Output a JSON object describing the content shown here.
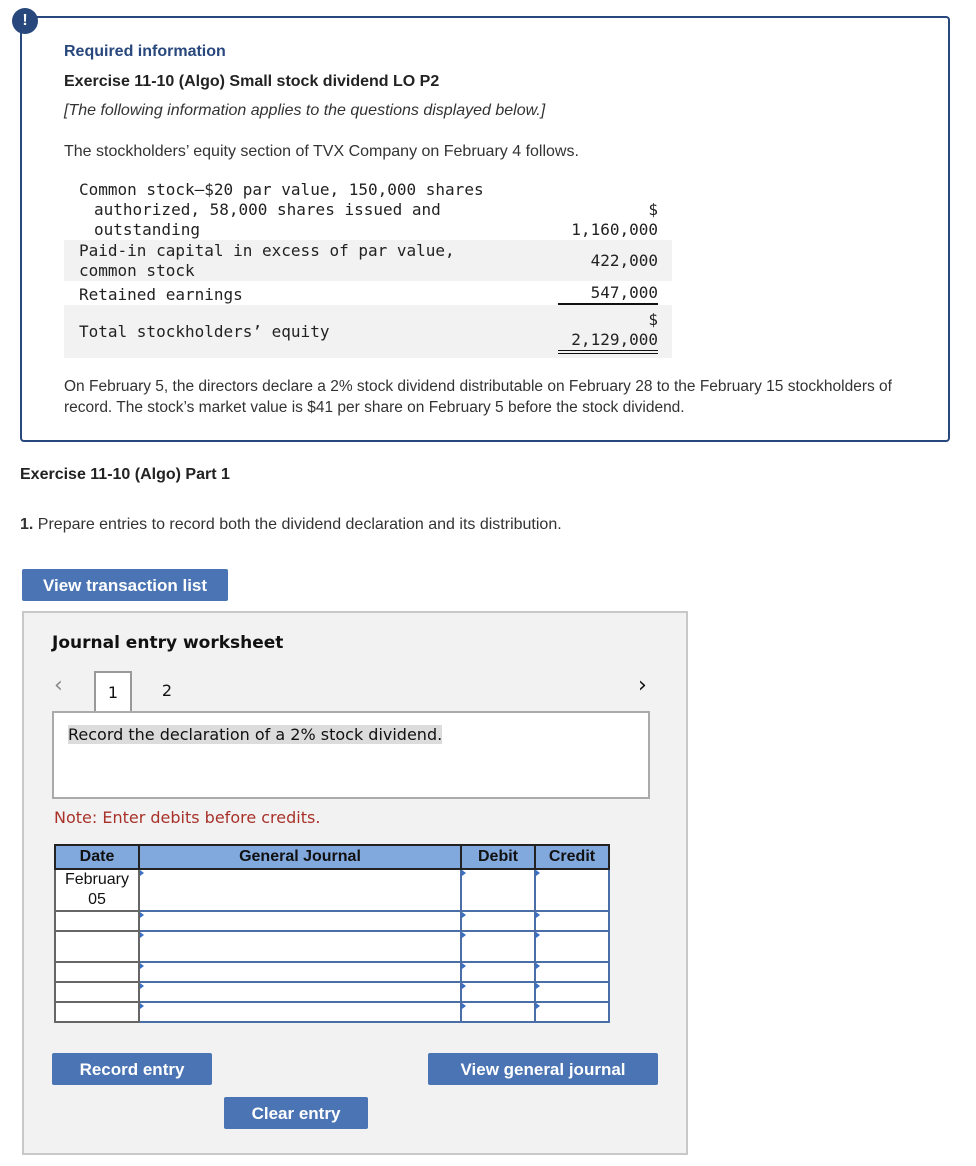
{
  "info": {
    "badge": "!",
    "required_label": "Required information",
    "exercise_title": "Exercise 11-10 (Algo) Small stock dividend LO P2",
    "applies_note": "[The following information applies to the questions displayed below.]",
    "intro": "The stockholders’ equity section of TVX Company on February 4 follows.",
    "equity_rows": [
      {
        "label_lines": [
          "Common stock—$20 par value, 150,000 shares",
          "authorized, 58,000 shares issued and",
          "outstanding"
        ],
        "currency": "$",
        "amount": "1,160,000"
      },
      {
        "label_lines": [
          "Paid-in capital in excess of par value,",
          "common stock"
        ],
        "currency": "",
        "amount": "422,000"
      },
      {
        "label_lines": [
          "Retained earnings"
        ],
        "currency": "",
        "amount": "547,000"
      },
      {
        "label_lines": [
          "Total stockholders’ equity"
        ],
        "currency": "$",
        "amount": "2,129,000"
      }
    ],
    "closing": "On February 5, the directors declare a 2% stock dividend distributable on February 28 to the February 15 stockholders of record. The stock’s market value is $41 per share on February 5 before the stock dividend."
  },
  "part": {
    "title": "Exercise 11-10 (Algo) Part 1",
    "question_number": "1.",
    "question_text": " Prepare entries to record both the dividend declaration and its distribution."
  },
  "buttons": {
    "view_transaction_list": "View transaction list",
    "record_entry": "Record entry",
    "clear_entry": "Clear entry",
    "view_general_journal": "View general journal"
  },
  "worksheet": {
    "title": "Journal entry worksheet",
    "prev_icon": "‹",
    "next_icon": "›",
    "tabs": [
      "1",
      "2"
    ],
    "active_tab": "1",
    "description": "Record the declaration of a 2% stock dividend.",
    "note": "Note: Enter debits before credits.",
    "columns": [
      "Date",
      "General Journal",
      "Debit",
      "Credit"
    ],
    "rows": [
      {
        "date_line1": "February",
        "date_line2": "05",
        "account": "",
        "debit": "",
        "credit": ""
      },
      {
        "date_line1": "",
        "date_line2": "",
        "account": "",
        "debit": "",
        "credit": ""
      },
      {
        "date_line1": "",
        "date_line2": "",
        "account": "",
        "debit": "",
        "credit": ""
      },
      {
        "date_line1": "",
        "date_line2": "",
        "account": "",
        "debit": "",
        "credit": ""
      },
      {
        "date_line1": "",
        "date_line2": "",
        "account": "",
        "debit": "",
        "credit": ""
      },
      {
        "date_line1": "",
        "date_line2": "",
        "account": "",
        "debit": "",
        "credit": ""
      }
    ]
  },
  "colors": {
    "accent_navy": "#28477d",
    "button_blue": "#4a74b4",
    "header_blue": "#82a9de",
    "note_red": "#a8322a"
  }
}
